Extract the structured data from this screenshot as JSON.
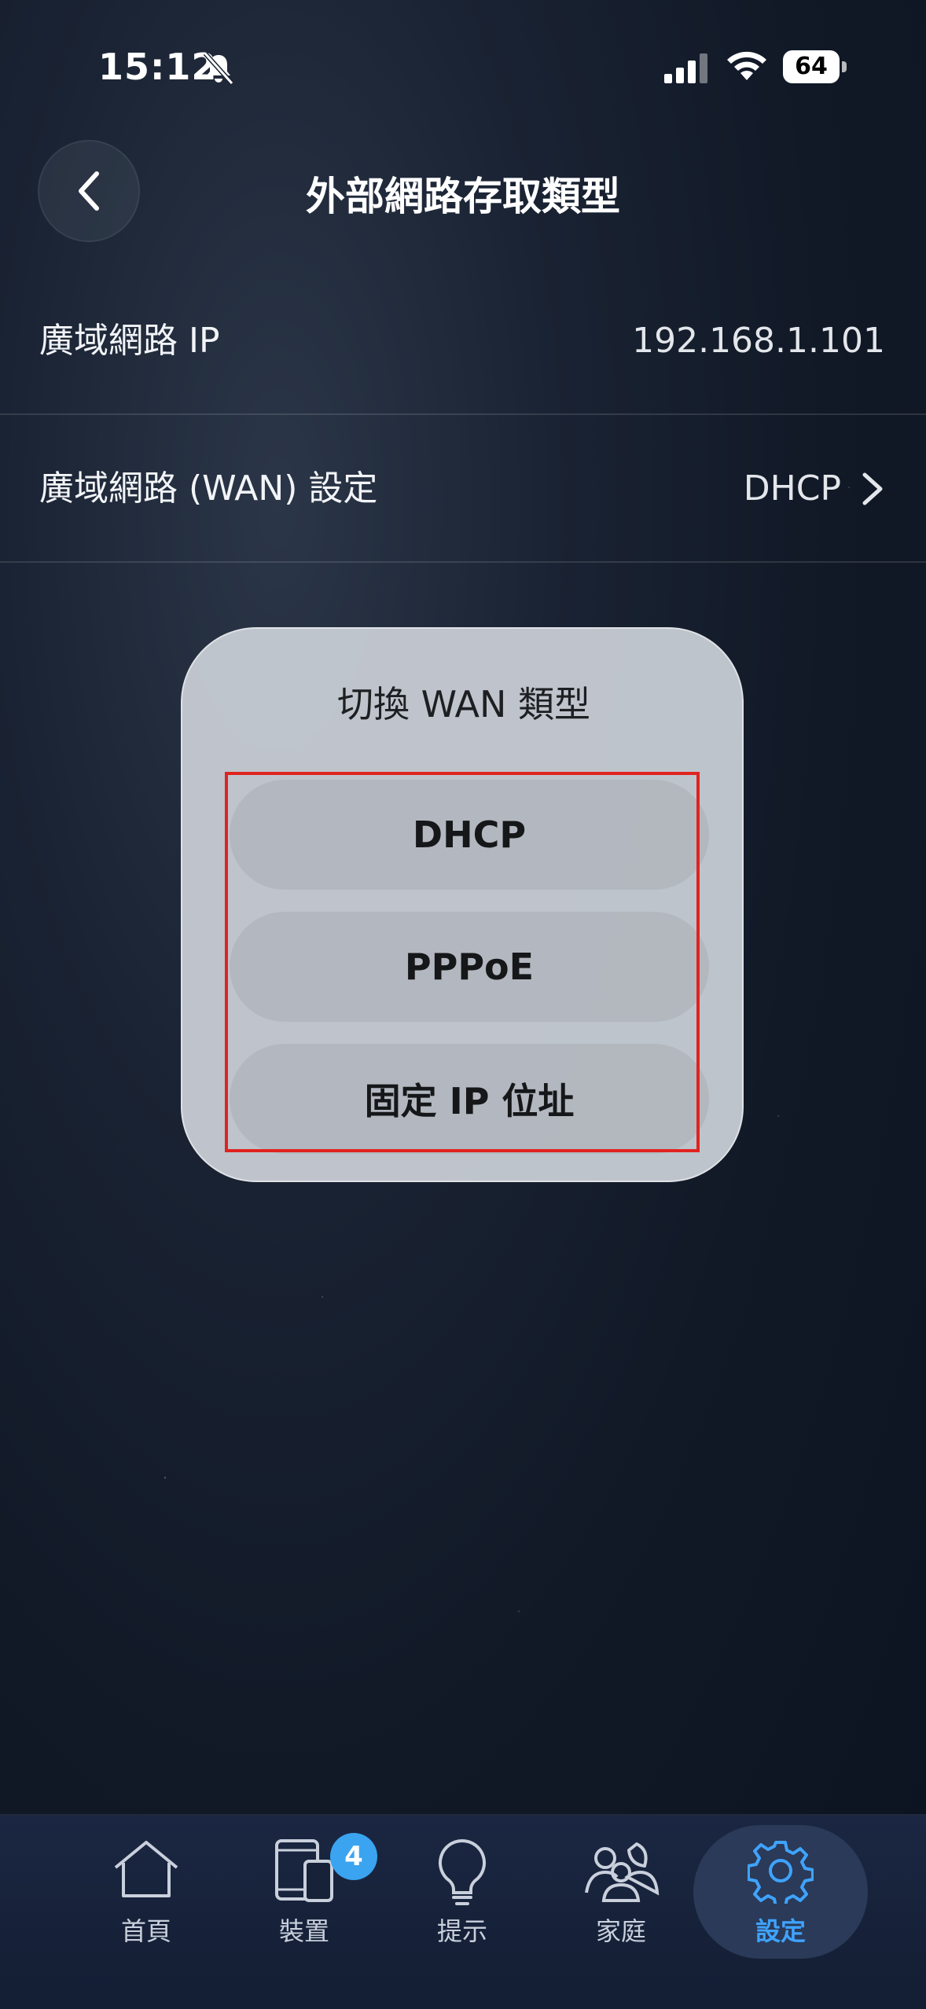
{
  "status_bar": {
    "time": "15:12",
    "battery": "64"
  },
  "header": {
    "title": "外部網路存取類型"
  },
  "rows": [
    {
      "label": "廣域網路 IP",
      "value": "192.168.1.101"
    },
    {
      "label": "廣域網路 (WAN) 設定",
      "value": "DHCP"
    }
  ],
  "dialog": {
    "title": "切換 WAN 類型",
    "options": [
      "DHCP",
      "PPPoE",
      "固定 IP 位址"
    ]
  },
  "tab_bar": {
    "tabs": [
      {
        "label": "首頁",
        "icon": "home-icon"
      },
      {
        "label": "裝置",
        "icon": "devices-icon",
        "badge": "4"
      },
      {
        "label": "提示",
        "icon": "lightbulb-icon"
      },
      {
        "label": "家庭",
        "icon": "family-icon"
      },
      {
        "label": "設定",
        "icon": "gear-icon",
        "active": true
      }
    ]
  },
  "colors": {
    "accent": "#3fa3ff",
    "highlight_border": "#e0231f",
    "badge": "#3aa4f0"
  }
}
